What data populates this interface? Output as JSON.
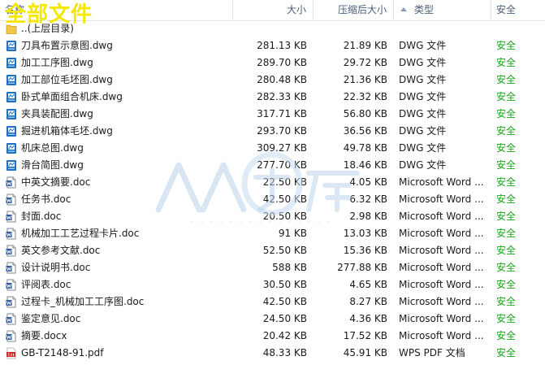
{
  "title_overlay": "全部文件",
  "columns": {
    "name": "名称",
    "size": "大小",
    "compressed": "压缩后大小",
    "type": "类型",
    "security": "安全"
  },
  "parent_row": {
    "name": "..(上层目录)"
  },
  "files": [
    {
      "name": "刀具布置示意图.dwg",
      "size": "281.13 KB",
      "compressed": "21.89 KB",
      "type": "DWG 文件",
      "security": "安全",
      "icon": "dwg-icon"
    },
    {
      "name": "加工工序图.dwg",
      "size": "289.70 KB",
      "compressed": "29.72 KB",
      "type": "DWG 文件",
      "security": "安全",
      "icon": "dwg-icon"
    },
    {
      "name": "加工部位毛坯图.dwg",
      "size": "280.48 KB",
      "compressed": "21.36 KB",
      "type": "DWG 文件",
      "security": "安全",
      "icon": "dwg-icon"
    },
    {
      "name": "卧式单面组合机床.dwg",
      "size": "282.33 KB",
      "compressed": "22.32 KB",
      "type": "DWG 文件",
      "security": "安全",
      "icon": "dwg-icon"
    },
    {
      "name": "夹具装配图.dwg",
      "size": "317.71 KB",
      "compressed": "56.80 KB",
      "type": "DWG 文件",
      "security": "安全",
      "icon": "dwg-icon"
    },
    {
      "name": "掘进机箱体毛坯.dwg",
      "size": "293.70 KB",
      "compressed": "36.56 KB",
      "type": "DWG 文件",
      "security": "安全",
      "icon": "dwg-icon"
    },
    {
      "name": "机床总图.dwg",
      "size": "309.27 KB",
      "compressed": "49.78 KB",
      "type": "DWG 文件",
      "security": "安全",
      "icon": "dwg-icon"
    },
    {
      "name": "滑台简图.dwg",
      "size": "277.70 KB",
      "compressed": "18.46 KB",
      "type": "DWG 文件",
      "security": "安全",
      "icon": "dwg-icon"
    },
    {
      "name": "中英文摘要.doc",
      "size": "22.50 KB",
      "compressed": "4.05 KB",
      "type": "Microsoft Word ...",
      "security": "安全",
      "icon": "doc-icon"
    },
    {
      "name": "任务书.doc",
      "size": "42.50 KB",
      "compressed": "6.32 KB",
      "type": "Microsoft Word ...",
      "security": "安全",
      "icon": "doc-icon"
    },
    {
      "name": "封面.doc",
      "size": "20.50 KB",
      "compressed": "2.98 KB",
      "type": "Microsoft Word ...",
      "security": "安全",
      "icon": "doc-icon"
    },
    {
      "name": "机械加工工艺过程卡片.doc",
      "size": "91 KB",
      "compressed": "13.03 KB",
      "type": "Microsoft Word ...",
      "security": "安全",
      "icon": "doc-icon"
    },
    {
      "name": "英文参考文献.doc",
      "size": "52.50 KB",
      "compressed": "15.36 KB",
      "type": "Microsoft Word ...",
      "security": "安全",
      "icon": "doc-icon"
    },
    {
      "name": "设计说明书.doc",
      "size": "588 KB",
      "compressed": "277.88 KB",
      "type": "Microsoft Word ...",
      "security": "安全",
      "icon": "doc-icon"
    },
    {
      "name": "评阅表.doc",
      "size": "30.50 KB",
      "compressed": "4.65 KB",
      "type": "Microsoft Word ...",
      "security": "安全",
      "icon": "doc-icon"
    },
    {
      "name": "过程卡_机械加工工序图.doc",
      "size": "42.50 KB",
      "compressed": "8.27 KB",
      "type": "Microsoft Word ...",
      "security": "安全",
      "icon": "doc-icon"
    },
    {
      "name": "鉴定意见.doc",
      "size": "24.50 KB",
      "compressed": "4.36 KB",
      "type": "Microsoft Word ...",
      "security": "安全",
      "icon": "doc-icon"
    },
    {
      "name": "摘要.docx",
      "size": "20.42 KB",
      "compressed": "17.52 KB",
      "type": "Microsoft Word ...",
      "security": "安全",
      "icon": "doc-icon"
    },
    {
      "name": "GB-T2148-91.pdf",
      "size": "48.33 KB",
      "compressed": "45.91 KB",
      "type": "WPS PDF 文档",
      "security": "安全",
      "icon": "pdf-icon"
    }
  ],
  "colors": {
    "safe": "#1aa31a",
    "header_text": "#4c607a",
    "overlay": "#f4e800",
    "dwg": "#1f6fc2",
    "pdf": "#d42b2b"
  }
}
